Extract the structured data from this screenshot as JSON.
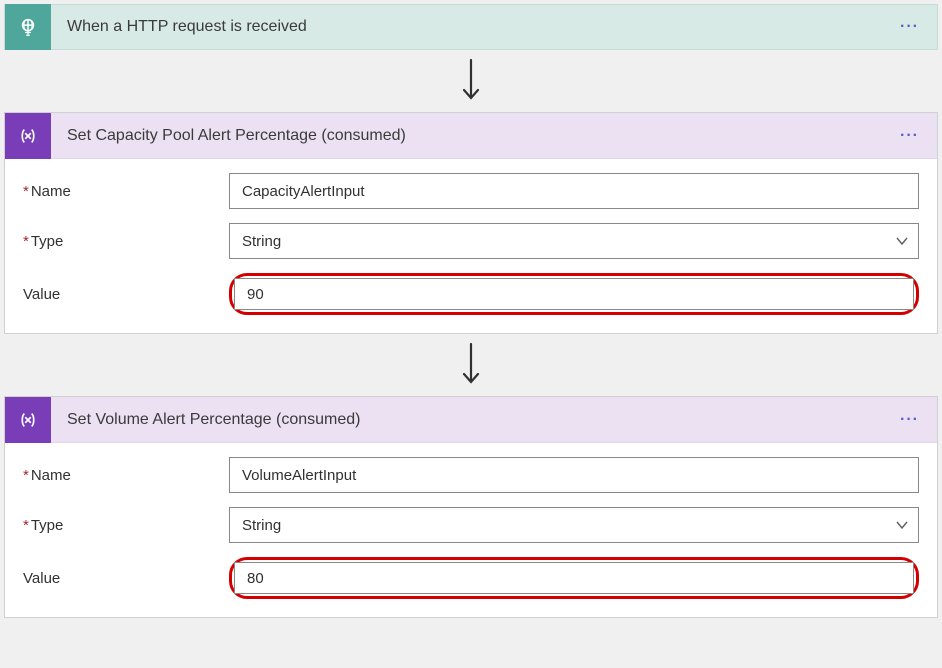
{
  "trigger": {
    "title": "When a HTTP request is received"
  },
  "step1": {
    "title": "Set Capacity Pool Alert Percentage (consumed)",
    "labels": {
      "name": "Name",
      "type": "Type",
      "value": "Value"
    },
    "values": {
      "name": "CapacityAlertInput",
      "type": "String",
      "value": "90"
    }
  },
  "step2": {
    "title": "Set Volume Alert Percentage (consumed)",
    "labels": {
      "name": "Name",
      "type": "Type",
      "value": "Value"
    },
    "values": {
      "name": "VolumeAlertInput",
      "type": "String",
      "value": "80"
    }
  },
  "menu_label": "···"
}
